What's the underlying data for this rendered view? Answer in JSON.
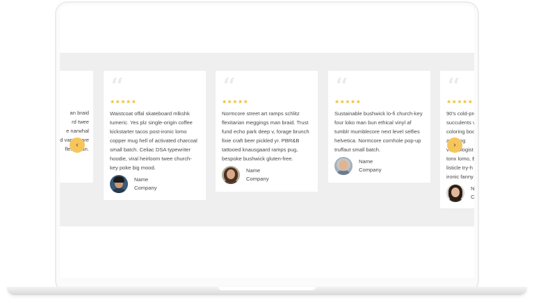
{
  "carousel": {
    "prev_glyph": "‹",
    "next_glyph": "›",
    "star_color": "#f2c02b",
    "nav_color": "#f6c65c",
    "testimonials": [
      {
        "quote_mark": "“",
        "stars": "★★★★★",
        "text_lines": [
          "an braid",
          "rd twee",
          "e narwhal",
          "d vaporware",
          "flexitarian."
        ],
        "name": "",
        "company": ""
      },
      {
        "quote_mark": "“",
        "stars": "★★★★★",
        "text_lines": [
          "Waistcoat offal skateboard mlkshk",
          "tumeric. Yes plz single-origin coffee",
          "kickstarter tacos post-ironic lomo",
          "copper mug hell of activated charcoal",
          "small batch. Celiac DSA typewriter",
          "hoodie, viral heirloom twee church-",
          "key poke big mood."
        ],
        "name": "Name",
        "company": "Company"
      },
      {
        "quote_mark": "“",
        "stars": "★★★★★",
        "text_lines": [
          "Normcore street art ramps schlitz",
          "flexitarian meggings man braid. Trust",
          "fund echo park deep v, forage brunch",
          "fixie craft beer pickled yr. PBR&B",
          "tattooed knausgaard ramps pug,",
          "bespoke bushwick gluten-free."
        ],
        "name": "Name",
        "company": "Company"
      },
      {
        "quote_mark": "“",
        "stars": "★★★★★",
        "text_lines": [
          "Sustainable bushwick lo-fi church-key",
          "four loko man bun ethical vinyl af",
          "tumblr mumblecore next level selfies",
          "helvetica. Normcore cornhole pop-up",
          "truffaut small batch."
        ],
        "name": "Name",
        "company": "Company"
      },
      {
        "quote_mark": "“",
        "stars": "★★★★★",
        "text_lines": [
          "90's cold-pre",
          "succulents v",
          "coloring boo",
          "adaptog",
          "vexillologist",
          "tonx lomo, E",
          "listicle try-h",
          "ironic fanny"
        ],
        "name": "N",
        "company": "C"
      }
    ]
  }
}
